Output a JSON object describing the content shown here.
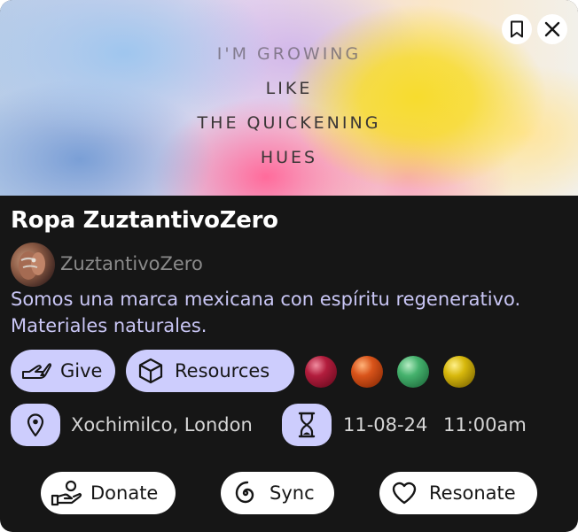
{
  "hero": {
    "lines": [
      "I'M GROWING",
      "LIKE",
      "THE QUICKENING",
      "HUES"
    ],
    "bookmark_icon": "bookmark-icon",
    "close_icon": "close-icon"
  },
  "card": {
    "title": "Ropa ZuztantivoZero",
    "author": "ZuztantivoZero",
    "description": "Somos una marca mexicana con espíritu regenerativo. Materiales naturales."
  },
  "tags": {
    "give_label": "Give",
    "give_icon": "hand-give-icon",
    "resources_label": "Resources",
    "resources_icon": "box-icon",
    "color_dots": [
      "#8a1328",
      "#c94a10",
      "#3aa264",
      "#c9a800"
    ]
  },
  "meta": {
    "location": "Xochimilco, London",
    "location_icon": "location-pin-icon",
    "date": "11-08-24",
    "time": "11:00am",
    "time_icon": "hourglass-icon"
  },
  "actions": {
    "donate_label": "Donate",
    "donate_icon": "donate-hand-icon",
    "sync_label": "Sync",
    "sync_icon": "spiral-icon",
    "resonate_label": "Resonate",
    "resonate_icon": "heart-icon"
  }
}
